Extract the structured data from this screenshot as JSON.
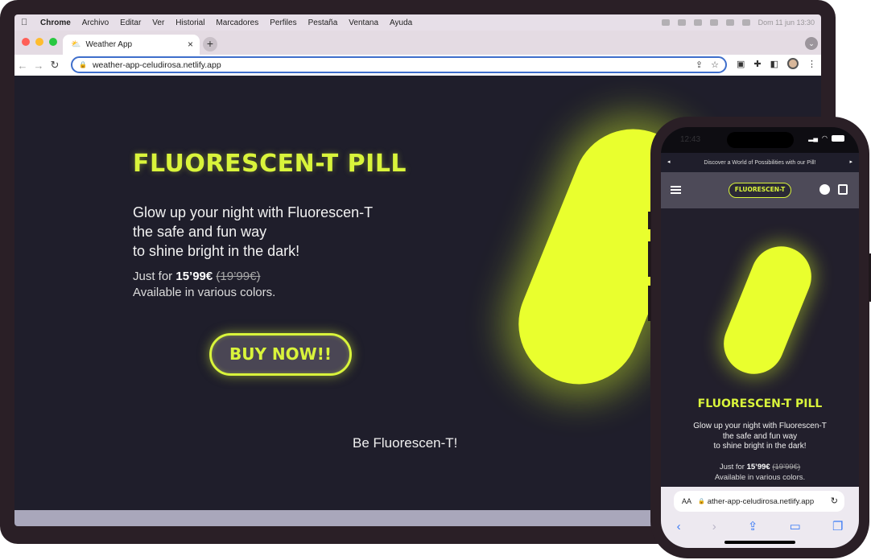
{
  "laptop": {
    "menubar": {
      "app": "Chrome",
      "items": [
        "Archivo",
        "Editar",
        "Ver",
        "Historial",
        "Marcadores",
        "Perfiles",
        "Pestaña",
        "Ventana",
        "Ayuda"
      ],
      "datetime": "Dom 11 jun 13:30"
    },
    "tab": {
      "title": "Weather App",
      "close": "×"
    },
    "new_tab": "+",
    "address": {
      "url": "weather-app-celudirosa.netlify.app"
    },
    "page": {
      "title": "FLUORESCEN-T PILL",
      "tagline_lines": [
        "Glow up your night with Fluorescen-T",
        "the safe and fun way",
        "to shine bright in the dark!"
      ],
      "price_prefix": "Just for ",
      "price_now": "15’99€",
      "price_old": "(19’99€)",
      "availability": "Available in various colors.",
      "buy_button": "BUY NOW!!",
      "slogan": "Be Fluorescen-T!"
    },
    "colors": {
      "accent": "#d9f43b",
      "background": "#1f1e2b",
      "pill": "#e9ff2e"
    }
  },
  "phone": {
    "status_time": "12:43",
    "announcement": "Discover a World of Possibilities with our Pill!",
    "logo": "FLUORESCEN-T",
    "title": "FLUORESCEN-T PILL",
    "tagline_lines": [
      "Glow up your night with Fluorescen-T",
      "the safe and fun way",
      "to shine bright in the dark!"
    ],
    "price_prefix": "Just for ",
    "price_now": "15’99€",
    "price_old": "(19’99€)",
    "availability": "Available in various colors.",
    "url_prefix": "AA",
    "url": "ather-app-celudirosa.netlify.app"
  }
}
